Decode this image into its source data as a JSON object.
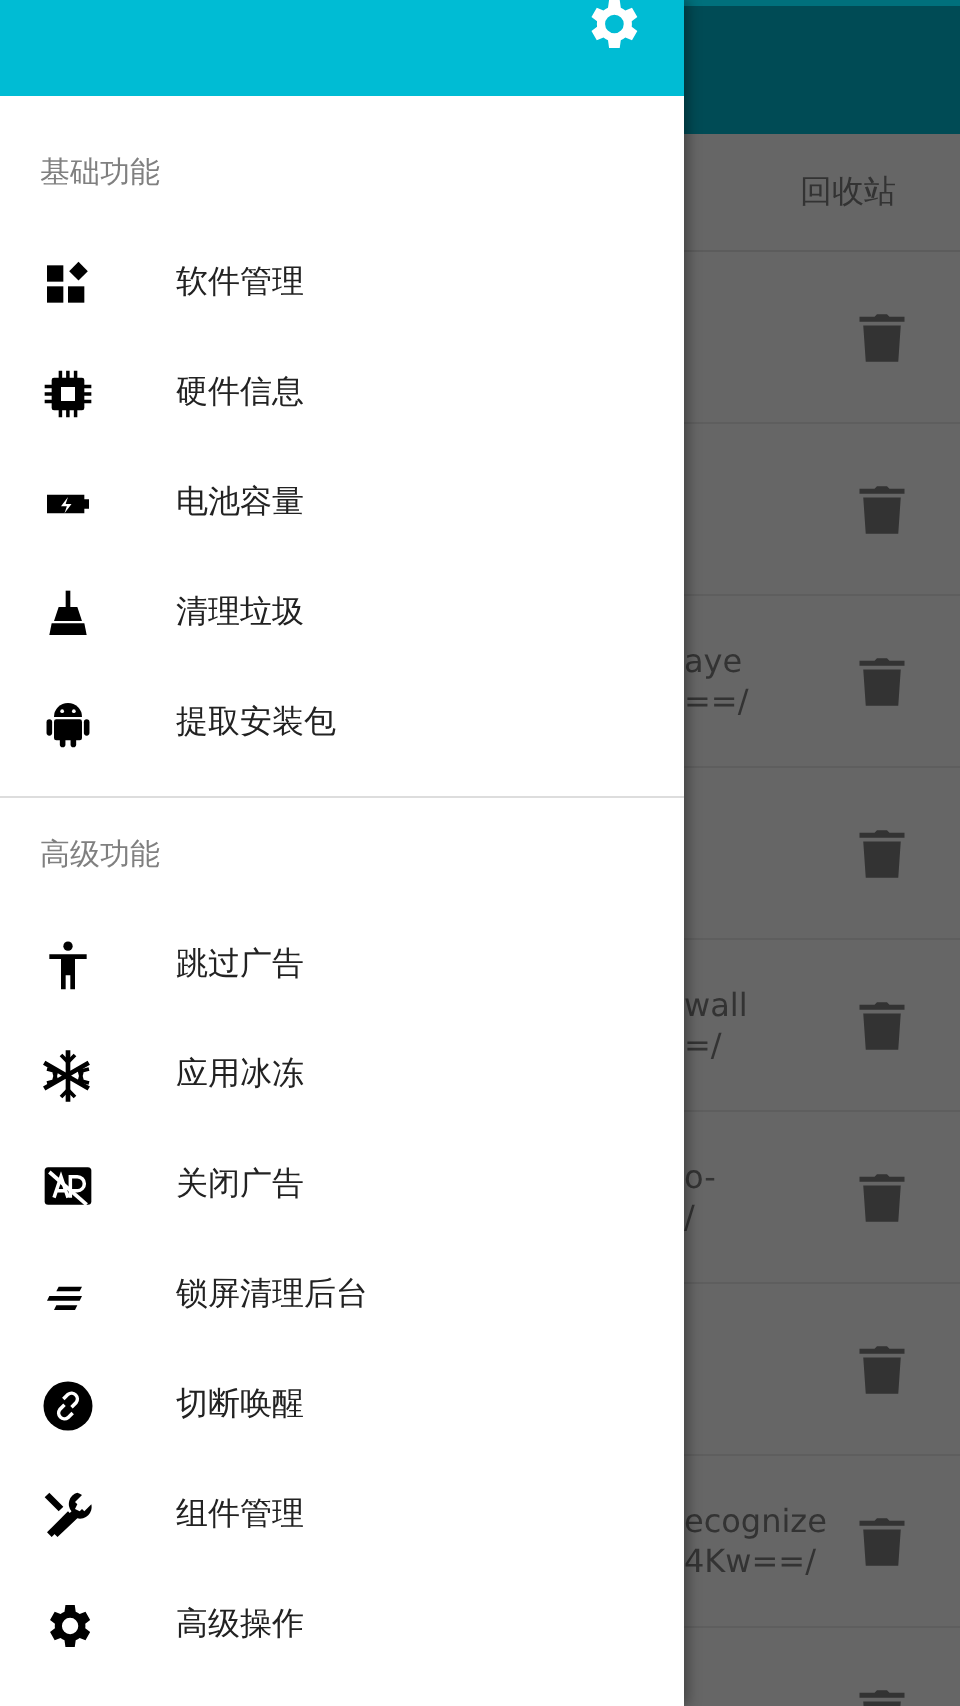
{
  "drawer": {
    "sections": [
      {
        "title": "基础功能",
        "items": [
          {
            "label": "软件管理",
            "kind": "apps"
          },
          {
            "label": "硬件信息",
            "kind": "chip"
          },
          {
            "label": "电池容量",
            "kind": "battery"
          },
          {
            "label": "清理垃圾",
            "kind": "broom"
          },
          {
            "label": "提取安装包",
            "kind": "android"
          }
        ]
      },
      {
        "title": "高级功能",
        "items": [
          {
            "label": "跳过广告",
            "kind": "person"
          },
          {
            "label": "应用冰冻",
            "kind": "snowflake"
          },
          {
            "label": "关闭广告",
            "kind": "adoff"
          },
          {
            "label": "锁屏清理后台",
            "kind": "lines"
          },
          {
            "label": "切断唤醒",
            "kind": "linkoff"
          },
          {
            "label": "组件管理",
            "kind": "tools"
          },
          {
            "label": "高级操作",
            "kind": "gear"
          }
        ]
      }
    ]
  },
  "background": {
    "tab": "回收站",
    "rows": [
      {},
      {},
      {
        "line_1": "aye",
        "line_2": "==/"
      },
      {},
      {
        "line_1": "wall",
        "line_2": "=/"
      },
      {
        "line_1": "o-",
        "line_2": "/"
      },
      {},
      {
        "line_1": "ecognize",
        "line_2": "4Kw==/"
      },
      {}
    ]
  }
}
